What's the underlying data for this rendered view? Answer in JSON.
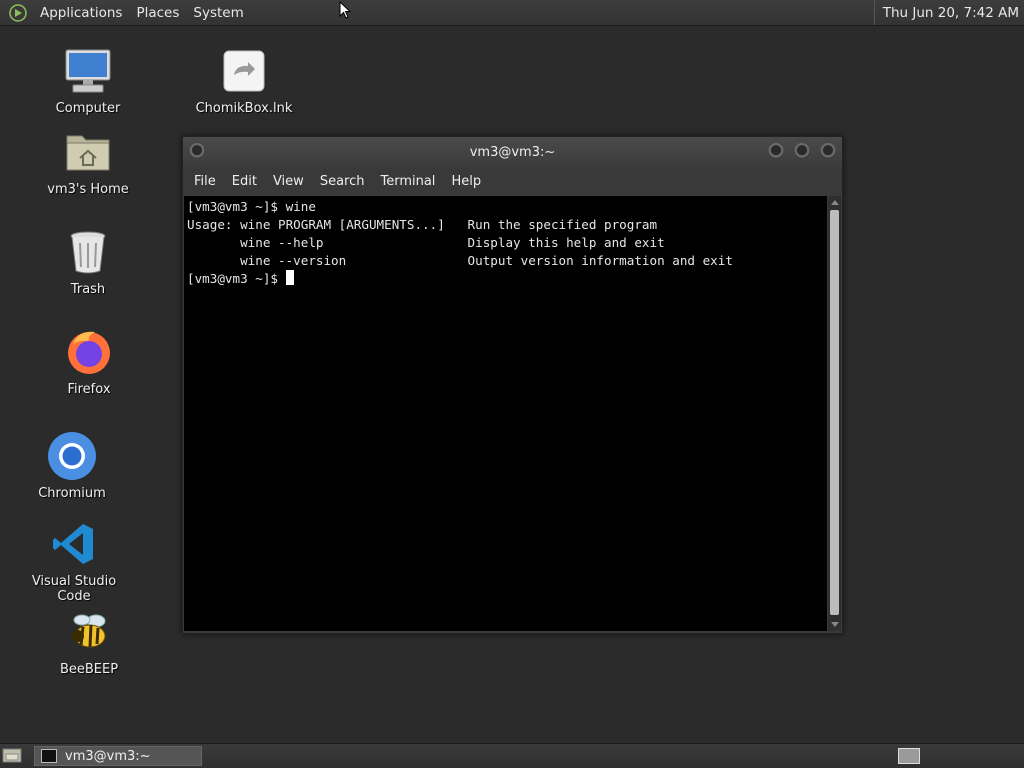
{
  "top_panel": {
    "menus": [
      "Applications",
      "Places",
      "System"
    ],
    "clock": "Thu Jun 20,  7:42 AM"
  },
  "desktop_icons": [
    {
      "label": "Computer",
      "icon": "computer-icon"
    },
    {
      "label": "ChomikBox.lnk",
      "icon": "shortcut-icon"
    },
    {
      "label": "vm3's Home",
      "icon": "home-folder-icon"
    },
    {
      "label": "Trash",
      "icon": "trash-icon"
    },
    {
      "label": "Firefox",
      "icon": "firefox-icon"
    },
    {
      "label": "Chromium",
      "icon": "chromium-icon"
    },
    {
      "label": "Visual Studio Code",
      "icon": "vscode-icon"
    },
    {
      "label": "BeeBEEP",
      "icon": "bee-icon"
    }
  ],
  "terminal": {
    "title": "vm3@vm3:~",
    "menus": [
      "File",
      "Edit",
      "View",
      "Search",
      "Terminal",
      "Help"
    ],
    "lines": [
      "[vm3@vm3 ~]$ wine",
      "Usage: wine PROGRAM [ARGUMENTS...]   Run the specified program",
      "       wine --help                   Display this help and exit",
      "       wine --version                Output version information and exit",
      "[vm3@vm3 ~]$ "
    ]
  },
  "taskbar": {
    "window_button": "vm3@vm3:~"
  }
}
